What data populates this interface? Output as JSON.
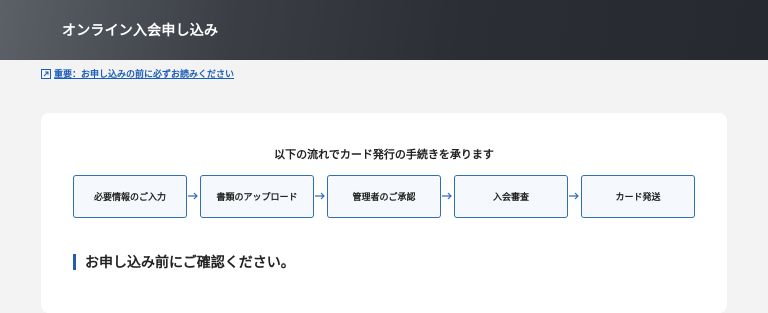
{
  "header": {
    "title": "オンライン入会申し込み"
  },
  "notice": {
    "icon": "external-link-icon",
    "link_text": "重要：お申し込みの前に必ずお読みください",
    "color": "#1a5db8"
  },
  "flow": {
    "heading": "以下の流れでカード発行の手続きを承ります",
    "steps": [
      {
        "label": "必要情報のご入力"
      },
      {
        "label": "書類のアップロード"
      },
      {
        "label": "管理者のご承認"
      },
      {
        "label": "入会審査"
      },
      {
        "label": "カード発送"
      }
    ],
    "accent_color": "#2f6fb8"
  },
  "section": {
    "heading": "お申し込み前にご確認ください。"
  }
}
